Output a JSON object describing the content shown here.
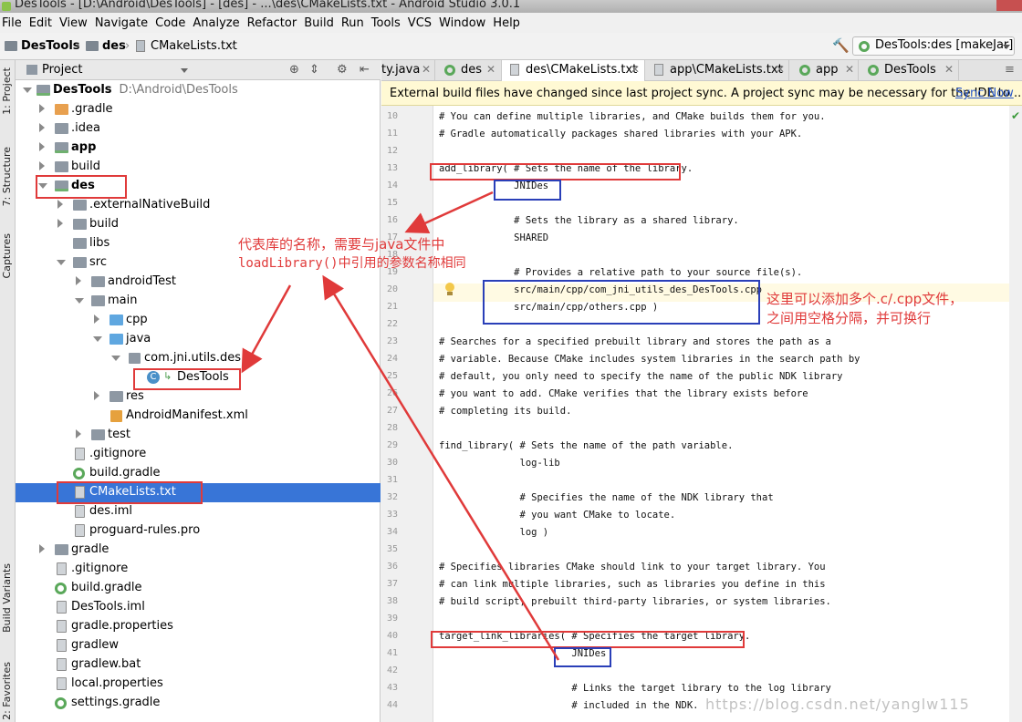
{
  "window": {
    "title": "DesTools - [D:\\Android\\DesTools] - [des] - ...\\des\\CMakeLists.txt - Android Studio 3.0.1"
  },
  "menu": [
    "File",
    "Edit",
    "View",
    "Navigate",
    "Code",
    "Analyze",
    "Refactor",
    "Build",
    "Run",
    "Tools",
    "VCS",
    "Window",
    "Help"
  ],
  "breadcrumb": [
    "DesTools",
    "des",
    "CMakeLists.txt"
  ],
  "run_config": "DesTools:des [makeJar]",
  "left_strip": {
    "project": "1: Project",
    "structure": "7: Structure",
    "captures": "Captures",
    "build_variants": "Build Variants",
    "favorites": "2: Favorites"
  },
  "project_panel": {
    "title": "Project"
  },
  "tree": [
    {
      "label": "DesTools",
      "path": "D:\\Android\\DesTools"
    },
    {
      "label": ".gradle"
    },
    {
      "label": ".idea"
    },
    {
      "label": "app"
    },
    {
      "label": "build"
    },
    {
      "label": "des"
    },
    {
      "label": ".externalNativeBuild"
    },
    {
      "label": "build"
    },
    {
      "label": "libs"
    },
    {
      "label": "src"
    },
    {
      "label": "androidTest"
    },
    {
      "label": "main"
    },
    {
      "label": "cpp"
    },
    {
      "label": "java"
    },
    {
      "label": "com.jni.utils.des"
    },
    {
      "label": "DesTools"
    },
    {
      "label": "res"
    },
    {
      "label": "AndroidManifest.xml"
    },
    {
      "label": "test"
    },
    {
      "label": ".gitignore"
    },
    {
      "label": "build.gradle"
    },
    {
      "label": "CMakeLists.txt"
    },
    {
      "label": "des.iml"
    },
    {
      "label": "proguard-rules.pro"
    },
    {
      "label": "gradle"
    },
    {
      "label": ".gitignore"
    },
    {
      "label": "build.gradle"
    },
    {
      "label": "DesTools.iml"
    },
    {
      "label": "gradle.properties"
    },
    {
      "label": "gradlew"
    },
    {
      "label": "gradlew.bat"
    },
    {
      "label": "local.properties"
    },
    {
      "label": "settings.gradle"
    }
  ],
  "tabs": [
    "ty.java",
    "des",
    "des\\CMakeLists.txt",
    "app\\CMakeLists.txt",
    "app",
    "DesTools"
  ],
  "notification": {
    "message": "External build files have changed since last project sync. A project sync may be necessary for the IDE to ...",
    "link": "Sync Now"
  },
  "code": [
    {
      "n": "10",
      "t": "# You can define multiple libraries, and CMake builds them for you."
    },
    {
      "n": "11",
      "t": "# Gradle automatically packages shared libraries with your APK."
    },
    {
      "n": "12",
      "t": ""
    },
    {
      "n": "13",
      "t": "add_library( # Sets the name of the library."
    },
    {
      "n": "14",
      "t": "             JNIDes"
    },
    {
      "n": "15",
      "t": ""
    },
    {
      "n": "16",
      "t": "             # Sets the library as a shared library."
    },
    {
      "n": "17",
      "t": "             SHARED"
    },
    {
      "n": "18",
      "t": ""
    },
    {
      "n": "19",
      "t": "             # Provides a relative path to your source file(s)."
    },
    {
      "n": "20",
      "t": "             src/main/cpp/com_jni_utils_des_DesTools.cpp"
    },
    {
      "n": "21",
      "t": "             src/main/cpp/others.cpp )"
    },
    {
      "n": "22",
      "t": ""
    },
    {
      "n": "23",
      "t": "# Searches for a specified prebuilt library and stores the path as a"
    },
    {
      "n": "24",
      "t": "# variable. Because CMake includes system libraries in the search path by"
    },
    {
      "n": "25",
      "t": "# default, you only need to specify the name of the public NDK library"
    },
    {
      "n": "26",
      "t": "# you want to add. CMake verifies that the library exists before"
    },
    {
      "n": "27",
      "t": "# completing its build."
    },
    {
      "n": "28",
      "t": ""
    },
    {
      "n": "29",
      "t": "find_library( # Sets the name of the path variable."
    },
    {
      "n": "30",
      "t": "              log-lib"
    },
    {
      "n": "31",
      "t": ""
    },
    {
      "n": "32",
      "t": "              # Specifies the name of the NDK library that"
    },
    {
      "n": "33",
      "t": "              # you want CMake to locate."
    },
    {
      "n": "34",
      "t": "              log )"
    },
    {
      "n": "35",
      "t": ""
    },
    {
      "n": "36",
      "t": "# Specifies libraries CMake should link to your target library. You"
    },
    {
      "n": "37",
      "t": "# can link multiple libraries, such as libraries you define in this"
    },
    {
      "n": "38",
      "t": "# build script, prebuilt third-party libraries, or system libraries."
    },
    {
      "n": "39",
      "t": ""
    },
    {
      "n": "40",
      "t": "target_link_libraries( # Specifies the target library."
    },
    {
      "n": "41",
      "t": "                       JNIDes"
    },
    {
      "n": "42",
      "t": ""
    },
    {
      "n": "43",
      "t": "                       # Links the target library to the log library"
    },
    {
      "n": "44",
      "t": "                       # included in the NDK."
    }
  ],
  "annotations": {
    "note1_line1": "代表库的名称，需要与java文件中",
    "note1_line2": "loadLibrary()中引用的参数名称相同",
    "note2_line1": "这里可以添加多个.c/.cpp文件，",
    "note2_line2": "之间用空格分隔，并可换行"
  },
  "watermark": "https://blog.csdn.net/yanglw115",
  "colors": {
    "accent_red": "#e03a3a",
    "accent_blue": "#2a3fb8",
    "selection": "#3875d7"
  }
}
